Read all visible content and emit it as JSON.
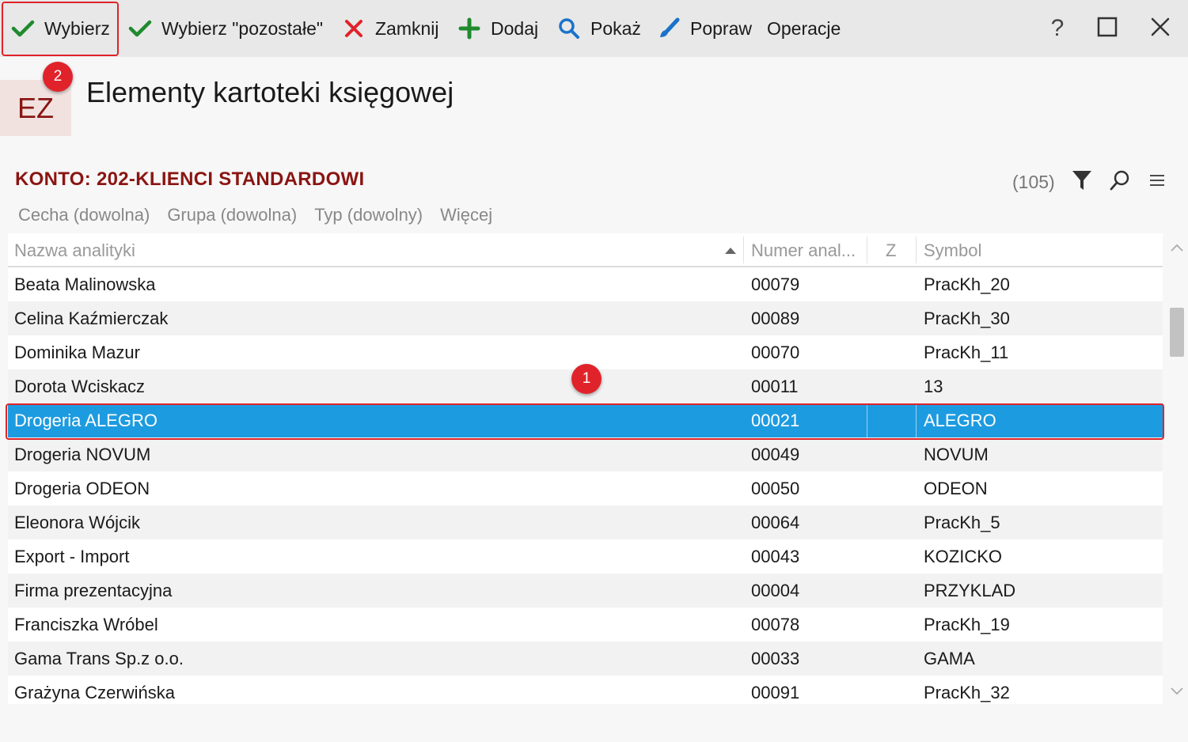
{
  "toolbar": {
    "select_label": "Wybierz",
    "select_rest_label": "Wybierz \"pozostałe\"",
    "close_label": "Zamknij",
    "add_label": "Dodaj",
    "show_label": "Pokaż",
    "edit_label": "Popraw",
    "operations_label": "Operacje",
    "help_label": "?"
  },
  "annotations": {
    "badge1": "1",
    "badge2": "2"
  },
  "header": {
    "icon_text": "EZ",
    "title": "Elementy kartoteki księgowej"
  },
  "account": {
    "label": "KONTO: 202-KLIENCI STANDARDOWI",
    "count": "(105)"
  },
  "filters": {
    "feature": "Cecha (dowolna)",
    "group": "Grupa (dowolna)",
    "type": "Typ (dowolny)",
    "more": "Więcej"
  },
  "grid": {
    "columns": {
      "name": "Nazwa analityki",
      "number": "Numer anal...",
      "z": "Z",
      "symbol": "Symbol"
    },
    "rows": [
      {
        "name": "Beata Malinowska",
        "number": "00079",
        "symbol": "PracKh_20"
      },
      {
        "name": "Celina Kaźmierczak",
        "number": "00089",
        "symbol": "PracKh_30"
      },
      {
        "name": "Dominika Mazur",
        "number": "00070",
        "symbol": "PracKh_11"
      },
      {
        "name": "Dorota Wciskacz",
        "number": "00011",
        "symbol": "13"
      },
      {
        "name": "Drogeria ALEGRO",
        "number": "00021",
        "symbol": "ALEGRO"
      },
      {
        "name": "Drogeria NOVUM",
        "number": "00049",
        "symbol": "NOVUM"
      },
      {
        "name": "Drogeria ODEON",
        "number": "00050",
        "symbol": "ODEON"
      },
      {
        "name": "Eleonora Wójcik",
        "number": "00064",
        "symbol": "PracKh_5"
      },
      {
        "name": "Export - Import",
        "number": "00043",
        "symbol": "KOZICKO"
      },
      {
        "name": "Firma prezentacyjna",
        "number": "00004",
        "symbol": "PRZYKLAD"
      },
      {
        "name": "Franciszka Wróbel",
        "number": "00078",
        "symbol": "PracKh_19"
      },
      {
        "name": "Gama Trans Sp.z o.o.",
        "number": "00033",
        "symbol": "GAMA"
      },
      {
        "name": "Grażyna Czerwińska",
        "number": "00091",
        "symbol": "PracKh_32"
      }
    ]
  },
  "colors": {
    "accent_red": "#e0232a",
    "title_red": "#8a1512",
    "selection_blue": "#1d9be0",
    "check_green": "#1f8a2e",
    "icon_blue": "#1a73c9"
  }
}
